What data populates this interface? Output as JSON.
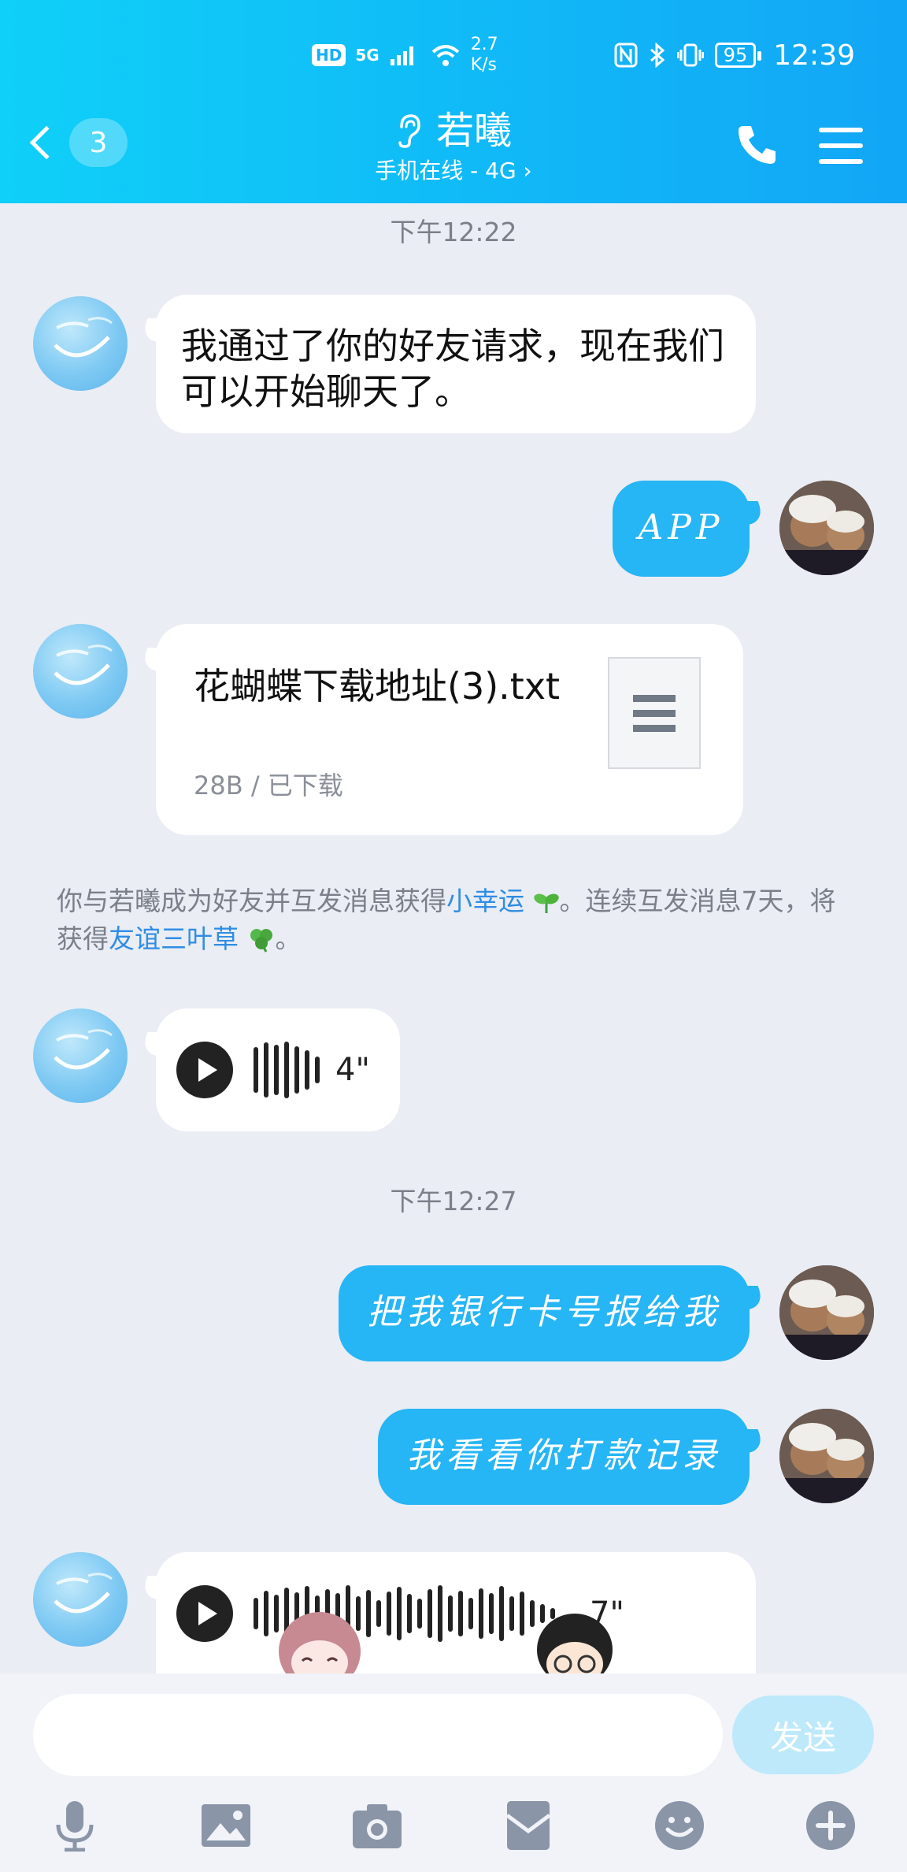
{
  "status_bar": {
    "hd": "HD",
    "network": "5G",
    "speed_value": "2.7",
    "speed_unit": "K/s",
    "battery": "95",
    "time": "12:39"
  },
  "header": {
    "back_count": "3",
    "title": "若曦",
    "subtitle": "手机在线 - 4G ›",
    "icons": [
      "back-chevron-icon",
      "ear-icon",
      "phone-icon",
      "menu-icon"
    ]
  },
  "messages": {
    "time1": "下午12:22",
    "m1_text": "我通过了你的好友请求，现在我们可以开始聊天了。",
    "m2_text": "APP",
    "file_name": "花蝴蝶下载地址(3).txt",
    "file_meta": "28B / 已下载",
    "notice": {
      "part1": "你与若曦成为好友并互发消息获得",
      "link1": "小幸运",
      "part2": "。连续互发消息7天，将获得",
      "link2": "友谊三叶草",
      "part3": "。"
    },
    "voice1_duration": "4\"",
    "time2": "下午12:27",
    "m3_text": "把我银行卡号报给我",
    "m4_text": "我看看你打款记录",
    "voice2_duration": "7\""
  },
  "input": {
    "value": "",
    "send_label": "发送"
  },
  "toolbar": [
    "microphone-icon",
    "image-icon",
    "camera-icon",
    "red-packet-icon",
    "emoji-icon",
    "plus-icon"
  ],
  "colors": {
    "header_start": "#0fd0f8",
    "header_end": "#12a6f6",
    "out_bubble": "#26b5f5",
    "chat_bg": "#eaedf4",
    "link": "#2f8de4"
  }
}
